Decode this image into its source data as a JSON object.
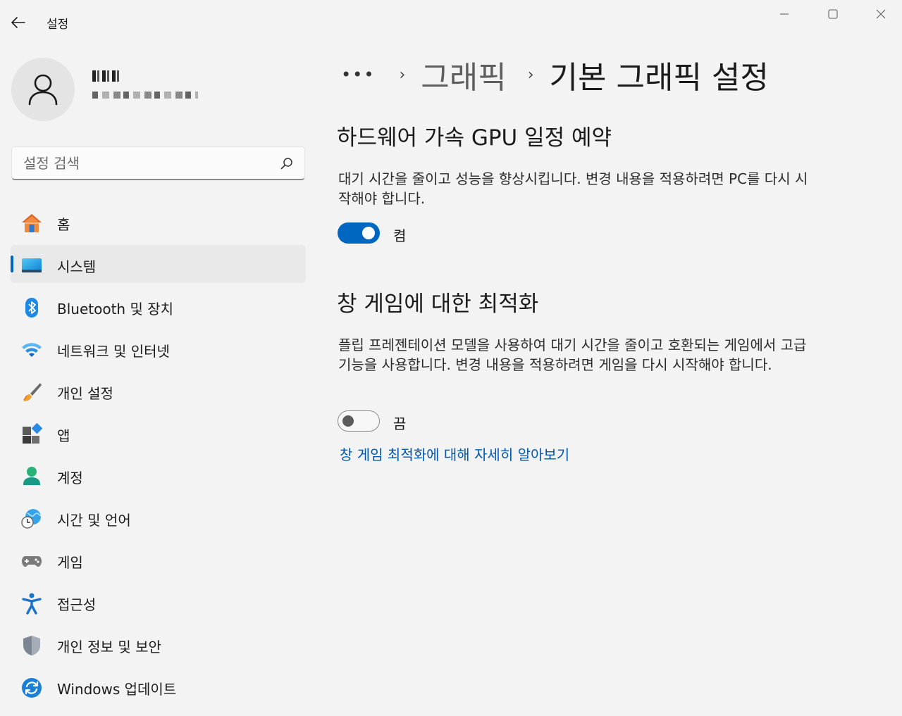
{
  "window": {
    "title": "설정"
  },
  "search": {
    "placeholder": "설정 검색"
  },
  "nav": {
    "items": [
      {
        "label": "홈"
      },
      {
        "label": "시스템"
      },
      {
        "label": "Bluetooth 및 장치"
      },
      {
        "label": "네트워크 및 인터넷"
      },
      {
        "label": "개인 설정"
      },
      {
        "label": "앱"
      },
      {
        "label": "계정"
      },
      {
        "label": "시간 및 언어"
      },
      {
        "label": "게임"
      },
      {
        "label": "접근성"
      },
      {
        "label": "개인 정보 및 보안"
      },
      {
        "label": "Windows 업데이트"
      }
    ],
    "active": "시스템"
  },
  "breadcrumb": {
    "more": "•••",
    "parent": "그래픽",
    "current": "기본 그래픽 설정"
  },
  "hags": {
    "title": "하드웨어 가속 GPU 일정 예약",
    "description": "대기 시간을 줄이고 성능을 향상시킵니다. 변경 내용을 적용하려면 PC를 다시 시작해야 합니다.",
    "state_label": "켬",
    "on": true
  },
  "windowed_games": {
    "title": "창 게임에 대한 최적화",
    "description": "플립 프레젠테이션 모델을 사용하여 대기 시간을 줄이고 호환되는 게임에서 고급 기능을 사용합니다. 변경 내용을 적용하려면 게임을 다시 시작해야 합니다.",
    "state_label": "끔",
    "on": false,
    "learn_more": "창 게임 최적화에 대해 자세히 알아보기"
  },
  "colors": {
    "accent": "#0067c0",
    "link": "#0058b0",
    "background": "#f3f3f3"
  }
}
